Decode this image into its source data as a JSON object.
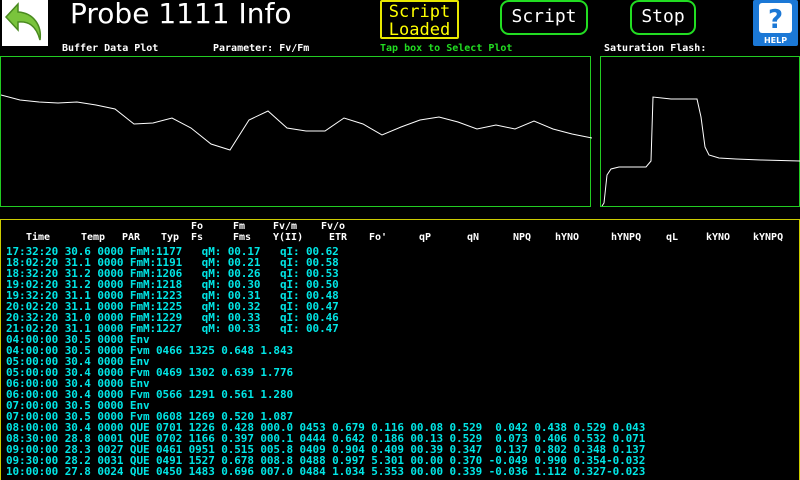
{
  "header": {
    "title": "Probe 1111 Info",
    "script_loaded": [
      "Script",
      "Loaded"
    ],
    "script_button": "Script",
    "stop_button": "Stop",
    "help_label": "HELP"
  },
  "labels": {
    "buffer_plot": "Buffer Data Plot",
    "parameter": "Parameter: Fv/Fm",
    "tap_hint": "Tap box to Select Plot",
    "saturation": "Saturation Flash:"
  },
  "colors": {
    "accent_green": "#22dd22",
    "accent_yellow": "#ffff00",
    "data_cyan": "#00e5e5",
    "help_blue": "#1b78d6"
  },
  "table": {
    "headers": {
      "time": "Time",
      "temp": "Temp",
      "par": "PAR",
      "typ": "Typ",
      "fo_fs": [
        "Fo",
        "Fs"
      ],
      "fm_fms": [
        "Fm",
        "Fms"
      ],
      "fvm_y": [
        "Fv/m",
        "Y(II)"
      ],
      "fvo_etr": [
        "Fv/o",
        "ETR"
      ],
      "fo_prime": "Fo'",
      "qp": "qP",
      "qn": "qN",
      "npq": "NPQ",
      "hyno": "hYNO",
      "hynpq": "hYNPQ",
      "ql": "qL",
      "kyno": "kYNO",
      "kynpq": "kYNPQ"
    },
    "rows": [
      "17:32:20 30.6 0000 FmM:1177   qM: 00.17   qI: 00.62",
      "18:02:20 31.1 0000 FmM:1191   qM: 00.21   qI: 00.58",
      "18:32:20 31.2 0000 FmM:1206   qM: 00.26   qI: 00.53",
      "19:02:20 31.2 0000 FmM:1218   qM: 00.30   qI: 00.50",
      "19:32:20 31.1 0000 FmM:1223   qM: 00.31   qI: 00.48",
      "20:02:20 31.1 0000 FmM:1225   qM: 00.32   qI: 00.47",
      "20:32:20 31.0 0000 FmM:1229   qM: 00.33   qI: 00.46",
      "21:02:20 31.1 0000 FmM:1227   qM: 00.33   qI: 00.47",
      "04:00:00 30.5 0000 Env",
      "04:00:00 30.5 0000 Fvm 0466 1325 0.648 1.843",
      "05:00:00 30.4 0000 Env",
      "05:00:00 30.4 0000 Fvm 0469 1302 0.639 1.776",
      "06:00:00 30.4 0000 Env",
      "06:00:00 30.4 0000 Fvm 0566 1291 0.561 1.280",
      "07:00:00 30.5 0000 Env",
      "07:00:00 30.5 0000 Fvm 0608 1269 0.520 1.087",
      "08:00:00 30.4 0000 QUE 0701 1226 0.428 000.0 0453 0.679 0.116 00.08 0.529  0.042 0.438 0.529 0.043",
      "08:30:00 28.8 0001 QUE 0702 1166 0.397 000.1 0444 0.642 0.186 00.13 0.529  0.073 0.406 0.532 0.071",
      "09:00:00 28.3 0027 QUE 0461 0951 0.515 005.8 0409 0.904 0.409 00.39 0.347  0.137 0.802 0.348 0.137",
      "09:30:00 28.2 0031 QUE 0491 1527 0.678 008.8 0488 0.997 5.301 00.00 0.370 -0.049 0.990 0.354-0.032",
      "10:00:00 27.8 0024 QUE 0450 1483 0.696 007.0 0484 1.034 5.353 00.00 0.339 -0.036 1.112 0.327-0.023"
    ]
  }
}
